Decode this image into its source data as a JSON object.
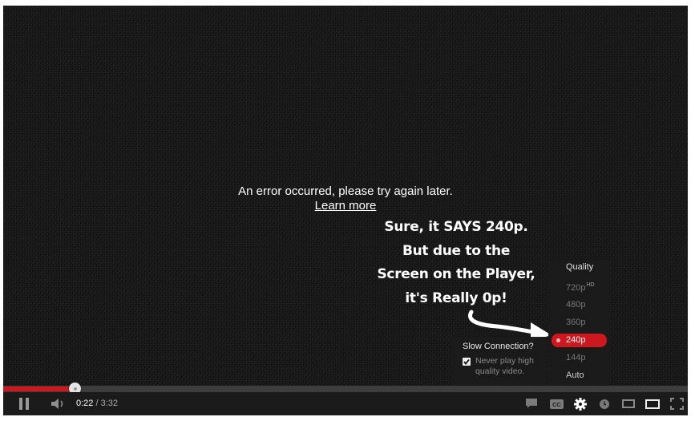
{
  "error": {
    "message": "An error occurred, please try again later.",
    "link": "Learn more"
  },
  "annotation": {
    "lines": [
      "Sure, it SAYS 240p.",
      "But due to the",
      "Screen on the Player,",
      "it's Really 0p!"
    ]
  },
  "quality_menu": {
    "title": "Quality",
    "items": [
      {
        "label": "720p",
        "badge": "HD"
      },
      {
        "label": "480p"
      },
      {
        "label": "360p"
      },
      {
        "label": "240p"
      },
      {
        "label": "144p"
      },
      {
        "label": "Auto"
      }
    ],
    "selected": "240p"
  },
  "slow_connection": {
    "title": "Slow Connection?",
    "checkbox_label": "Never play high quality video.",
    "checked": true
  },
  "progress": {
    "current": "0:22",
    "separator": "/",
    "duration": "3:32",
    "played_fraction": 0.104
  },
  "controls": {
    "left": [
      "pause-icon",
      "volume-icon"
    ],
    "right": [
      "annotations-icon",
      "captions-icon",
      "settings-gear-icon",
      "watch-later-icon",
      "small-player-icon",
      "large-player-icon",
      "fullscreen-icon"
    ],
    "captions_label": "CC"
  },
  "colors": {
    "accent": "#cc181e",
    "background": "#1b1b1b"
  }
}
